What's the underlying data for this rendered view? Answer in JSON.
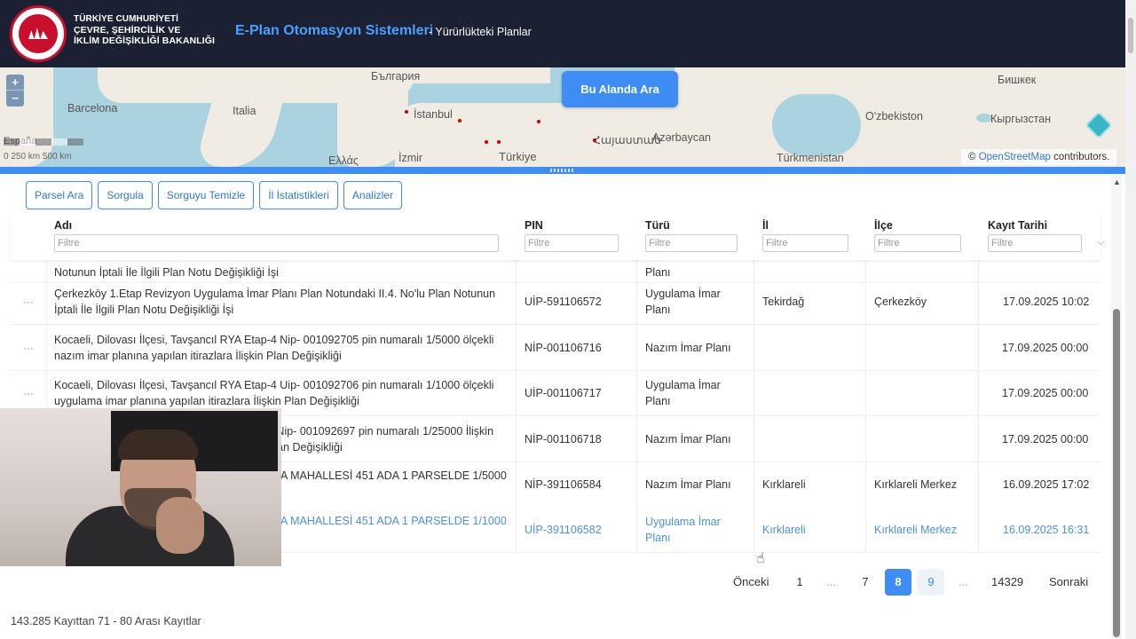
{
  "header": {
    "ministry_lines": [
      "TÜRKİYE CUMHURİYETİ",
      "ÇEVRE, ŞEHİRCİLİK VE",
      "İKLİM DEĞİŞİKLİĞİ BAKANLIĞI"
    ],
    "app_title": "E-Plan Otomasyon Sistemleri",
    "app_subtitle": "- Yürürlükteki Planlar"
  },
  "map": {
    "labels": [
      "Barcelona",
      "Italia",
      "България",
      "İstanbul",
      "İzmir",
      "Ελλάς",
      "Türkiye",
      "Հայաստան",
      "Azərbaycan",
      "Türkmenistan",
      "O'zbekiston",
      "Кыргызстан",
      "Бишкек",
      "España"
    ],
    "search_area_button": "Bu Alanda Ara",
    "zoom_in": "+",
    "zoom_out": "−",
    "scale_text": "0    250 km 500 km",
    "attribution_prefix": "©",
    "attribution_link": "OpenStreetMap",
    "attribution_suffix": "contributors."
  },
  "toolbar": {
    "buttons": [
      "Parsel Ara",
      "Sorgula",
      "Sorguyu Temizle",
      "İl İstatistikleri",
      "Analizler"
    ]
  },
  "table": {
    "columns": [
      "Adı",
      "PIN",
      "Türü",
      "İl",
      "İlçe",
      "Kayıt Tarihi"
    ],
    "filter_placeholder": "Filtre",
    "partial_row": {
      "name": "Notunun İptali İle İlgili Plan Notu Değişikliği İşi",
      "type": "Planı"
    },
    "rows": [
      {
        "name": "Çerkezköy 1.Etap Revizyon Uygulama İmar Planı Plan Notundaki II.4. No'lu Plan Notunun İptali İle İlgili Plan Notu Değişikliği İşi",
        "pin": "UİP-591106572",
        "type": "Uygulama İmar Planı",
        "il": "Tekirdağ",
        "ilce": "Çerkezköy",
        "date": "17.09.2025 10:02"
      },
      {
        "name": "Kocaeli, Dilovası İlçesi, Tavşancıl RYA Etap-4 Nip- 001092705 pin numaralı 1/5000 ölçekli nazım imar planına yapılan itirazlara İlişkin Plan Değişikliği",
        "pin": "NİP-001106716",
        "type": "Nazım İmar Planı",
        "il": "",
        "ilce": "",
        "date": "17.09.2025 00:00"
      },
      {
        "name": "Kocaeli, Dilovası İlçesi, Tavşancıl RYA Etap-4 Uip- 001092706 pin numaralı 1/1000 ölçekli uygulama imar planına yapılan itirazlara İlişkin Plan Değişikliği",
        "pin": "UİP-001106717",
        "type": "Uygulama İmar Planı",
        "il": "",
        "ilce": "",
        "date": "17.09.2025 00:00"
      },
      {
        "name": "4 Nip- 001092697 pin numaralı 1/25000 İlişkin Plan Değişikliği",
        "pin": "NİP-001106718",
        "type": "Nazım İmar Planı",
        "il": "",
        "ilce": "",
        "date": "17.09.2025 00:00"
      },
      {
        "name": "A MAHALLESİ 451 ADA 1 PARSELDE 1/5000",
        "pin": "NİP-391106584",
        "type": "Nazım İmar Planı",
        "il": "Kırklareli",
        "ilce": "Kırklareli Merkez",
        "date": "16.09.2025 17:02"
      },
      {
        "name": "A MAHALLESİ 451 ADA 1 PARSELDE 1/1000",
        "pin": "UİP-391106582",
        "type": "Uygulama İmar Planı",
        "il": "Kırklareli",
        "ilce": "Kırklareli Merkez",
        "date": "16.09.2025 16:31"
      }
    ],
    "row_menu": "···"
  },
  "pagination": {
    "prev": "Önceki",
    "pages": [
      "1",
      "...",
      "7",
      "8",
      "9",
      "...",
      "14329"
    ],
    "current": "8",
    "next": "Sonraki"
  },
  "records_summary": "143.285 Kayıttan 71 - 80 Arası Kayıtlar",
  "colors": {
    "header_bg": "#1b2033",
    "accent": "#3d8df5",
    "link": "#4a90e2"
  }
}
